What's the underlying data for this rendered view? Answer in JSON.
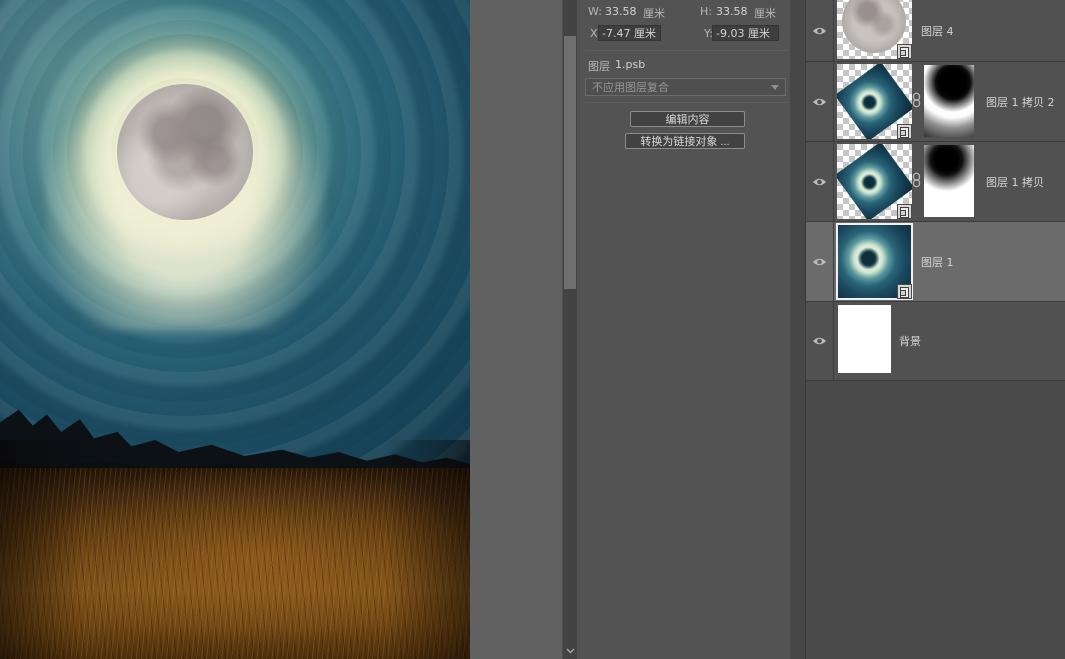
{
  "properties": {
    "w_label": "W:",
    "w_value": "33.58",
    "w_unit": "厘米",
    "h_label": "H:",
    "h_value": "33.58",
    "h_unit": "厘米",
    "x_label": "X:",
    "x_value": "-7.47 厘米",
    "y_label": "Y:",
    "y_value": "-9.03 厘米",
    "layer_label": "图层",
    "layer_file": "1.psb",
    "layer_comp_placeholder": "不应用图层复合",
    "edit_content_button": "编辑内容",
    "convert_linked_button": "转换为链接对象 ..."
  },
  "layers": {
    "rows": [
      {
        "label": "图层 4",
        "selected": false,
        "thumb": "moon",
        "has_mask": false,
        "smart_object": true
      },
      {
        "label": "图层 1 拷贝 2",
        "selected": false,
        "thumb": "vortex-rotated",
        "has_mask": true,
        "linked_mask": true,
        "smart_object": true
      },
      {
        "label": "图层 1 拷贝",
        "selected": false,
        "thumb": "vortex-rotated",
        "has_mask": true,
        "linked_mask": true,
        "smart_object": true
      },
      {
        "label": "图层 1",
        "selected": true,
        "thumb": "vortex-full",
        "has_mask": false,
        "smart_object": true
      },
      {
        "label": "背景",
        "selected": false,
        "thumb": "white",
        "has_mask": false,
        "smart_object": false
      }
    ]
  },
  "colors": {
    "panel_bg": "#535353",
    "layers_row_bg": "#515151",
    "selected_row_bg": "#6b6b6b",
    "pasteboard": "#616161",
    "field_bg": "#3e3e3e",
    "sky_teal": "#2f6a7e",
    "moon_glow": "#f2f0d8",
    "grass_orange": "#7b5019"
  }
}
